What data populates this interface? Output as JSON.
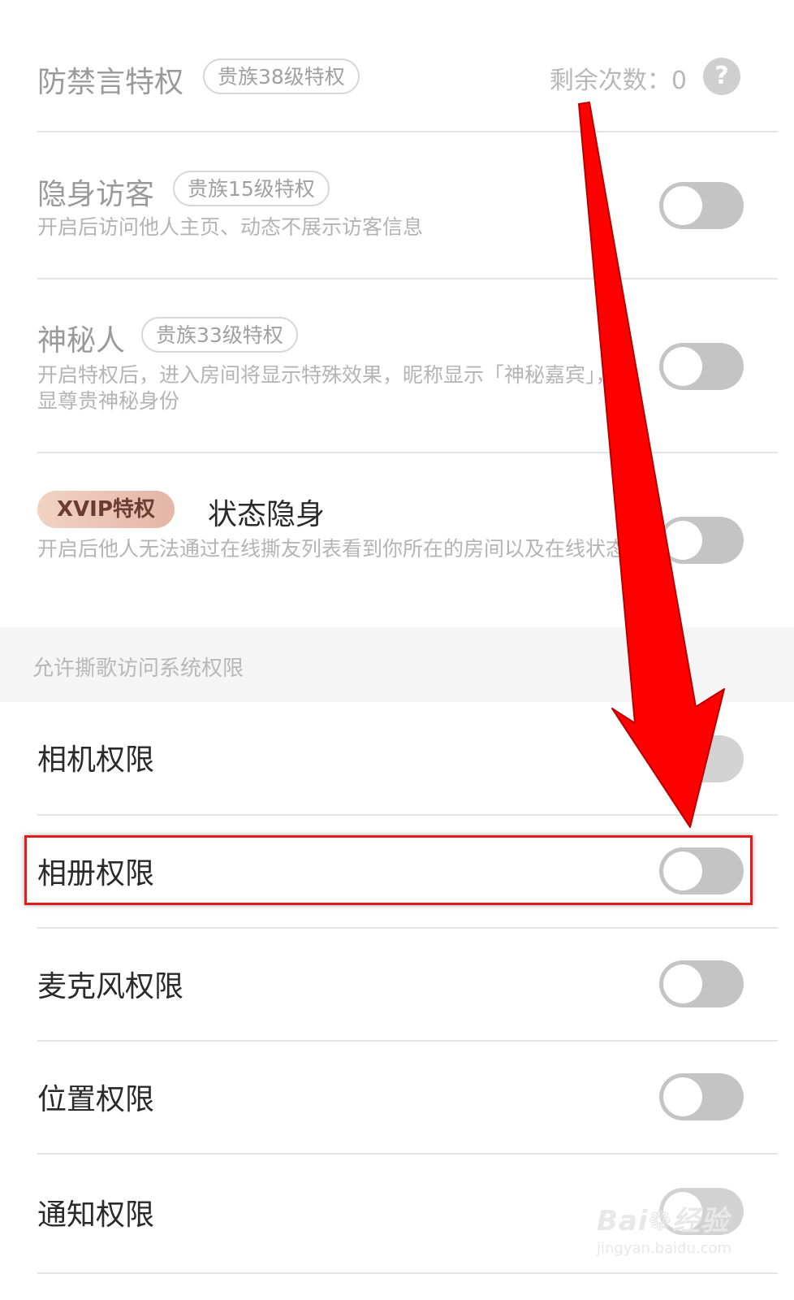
{
  "privileges": {
    "ban_protect": {
      "title": "防禁言特权",
      "badge": "贵族38级特权",
      "remaining_label": "剩余次数：",
      "remaining_count": "0",
      "help_label": "?"
    },
    "invisible_visitor": {
      "title": "隐身访客",
      "badge": "贵族15级特权",
      "desc": "开启后访问他人主页、动态不展示访客信息",
      "enabled": false
    },
    "mystery_person": {
      "title": "神秘人",
      "badge": "贵族33级特权",
      "desc": "开启特权后，进入房间将显示特殊效果，昵称显示「神秘嘉宾」，彰显尊贵神秘身份",
      "enabled": false
    },
    "status_invisible": {
      "badge": "XVIP特权",
      "title": "状态隐身",
      "desc": "开启后他人无法通过在线撕友列表看到你所在的房间以及在线状态",
      "enabled": false
    }
  },
  "system_permissions": {
    "section_title": "允许撕歌访问系统权限",
    "camera": {
      "label": "相机权限",
      "enabled": false
    },
    "album": {
      "label": "相册权限",
      "enabled": false
    },
    "microphone": {
      "label": "麦克风权限",
      "enabled": false
    },
    "location": {
      "label": "位置权限",
      "enabled": false
    },
    "notification": {
      "label": "通知权限",
      "enabled": false
    }
  },
  "overlay": {
    "arrow_color": "#ff0000",
    "highlight_color": "#e41b1b",
    "watermark_brand": "Bai",
    "watermark_suffix": "经验",
    "watermark_url": "jingyan.baidu.com"
  },
  "colors": {
    "toggle_off": "#c4c4c4",
    "divider": "#e4e4e4",
    "section_bg": "#f5f5f5"
  }
}
